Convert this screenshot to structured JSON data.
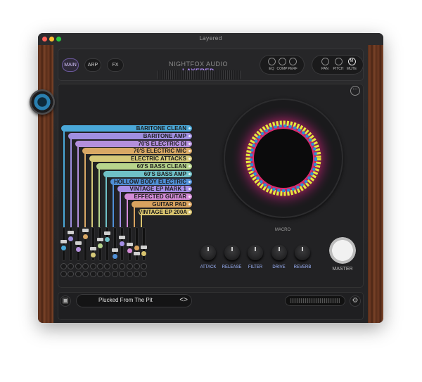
{
  "window": {
    "title": "Layered"
  },
  "header": {
    "tabs": [
      {
        "label": "MAIN"
      },
      {
        "label": "ARP"
      },
      {
        "label": "FX"
      }
    ],
    "brand": {
      "name": "NIGHTFOX AUDIO",
      "product": "LAYERED"
    },
    "fx_buttons": [
      {
        "label": "EQ"
      },
      {
        "label": "COMP"
      },
      {
        "label": "PERF"
      }
    ],
    "mix_buttons": [
      {
        "label": "PAN"
      },
      {
        "label": "PITCH"
      },
      {
        "label": "MUTE",
        "icon_text": "M"
      }
    ]
  },
  "layers": [
    {
      "label": "BARITONE CLEAN",
      "color": "#4aa8d8"
    },
    {
      "label": "BARITONE AMP",
      "color": "#9f8fe0"
    },
    {
      "label": "70'S ELECTRIC DI",
      "color": "#b38fdc"
    },
    {
      "label": "70'S ELECTRIC MIC",
      "color": "#d9a865"
    },
    {
      "label": "ELECTRIC ATTACKS",
      "color": "#d6c979"
    },
    {
      "label": "60'S BASS CLEAN",
      "color": "#b7d48c"
    },
    {
      "label": "60'S BASS AMP",
      "color": "#6fc0c7"
    },
    {
      "label": "HOLLOW BODY ELECTRIC",
      "color": "#4f8fd6"
    },
    {
      "label": "VINTAGE EP MARK 1",
      "color": "#a58ee6"
    },
    {
      "label": "EFFECTED GUITAR",
      "color": "#d58cd8"
    },
    {
      "label": "GUITAR PAD",
      "color": "#d9a35f"
    },
    {
      "label": "VINTAGE EP 200A",
      "color": "#d9c46f"
    }
  ],
  "macro": {
    "label": "MACRO"
  },
  "macro_knobs": [
    {
      "label": "ATTACK"
    },
    {
      "label": "RELEASE"
    },
    {
      "label": "FILTER"
    },
    {
      "label": "DRIVE"
    },
    {
      "label": "REVERB"
    }
  ],
  "master": {
    "label": "MASTER"
  },
  "preset": {
    "name": "Plucked From The Pit",
    "nav": "<>"
  },
  "icons": {
    "save": "save-icon",
    "settings": "gear-icon",
    "options": "dots-icon"
  }
}
